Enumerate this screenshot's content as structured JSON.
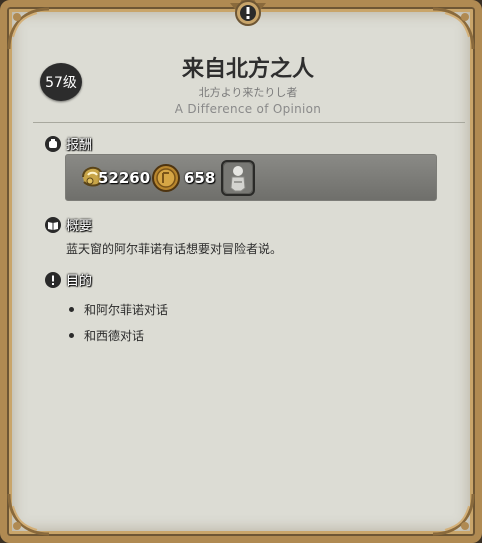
{
  "quest": {
    "level": "57级",
    "title": "来自北方之人",
    "title_jp": "北方より来たりし者",
    "title_en": "A Difference of Opinion"
  },
  "rewards": {
    "heading": "报酬",
    "heading_icon": "coin-bag-icon",
    "exp_icon": "experience-icon",
    "exp_value": "52260",
    "gil_icon": "gil-coin-icon",
    "gil_value": "658",
    "item_icon": "armor-item-icon"
  },
  "summary": {
    "heading": "概要",
    "heading_icon": "book-icon",
    "text": "蓝天窗的阿尔菲诺有话想要对冒险者说。"
  },
  "objectives": {
    "heading": "目的",
    "heading_icon": "exclamation-icon",
    "items": [
      "和阿尔菲诺对话",
      "和西德对话"
    ]
  },
  "colors": {
    "frame_gold": "#b08a52",
    "panel_bg": "#dcdcd4",
    "level_badge_bg": "#2c2c2c"
  }
}
